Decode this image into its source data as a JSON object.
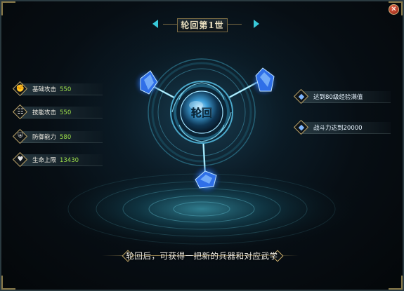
{
  "title": "轮回第1世",
  "emblem_label": "轮回",
  "stats": [
    {
      "label": "基础攻击",
      "value": "550",
      "icon": "fist-icon"
    },
    {
      "label": "技能攻击",
      "value": "550",
      "icon": "scroll-icon"
    },
    {
      "label": "防御能力",
      "value": "580",
      "icon": "shield-icon"
    },
    {
      "label": "生命上限",
      "value": "13430",
      "icon": "heart-icon"
    }
  ],
  "requirements": [
    {
      "label": "达到80级经验满值",
      "icon": "blue-gem-icon"
    },
    {
      "label": "战斗力达到20000",
      "icon": "blue-gem-icon"
    }
  ],
  "bottom_text": "轮回后，可获得一把新的兵器和对应武学",
  "colors": {
    "accent_cyan": "#38c9d9",
    "value_green": "#9fe24a",
    "gold_border": "#bfa66a",
    "crystal_blue": "#3a8cff"
  }
}
